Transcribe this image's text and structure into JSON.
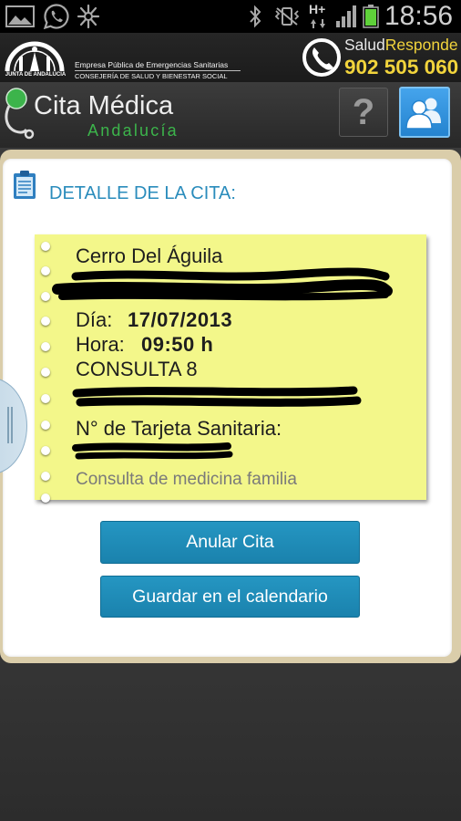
{
  "status_bar": {
    "time": "18:56",
    "network_type": "H+",
    "icons": {
      "notifications": [
        "gallery-icon",
        "whatsapp-icon",
        "burst-icon"
      ],
      "system": [
        "bluetooth-icon",
        "vibrate-icon",
        "signal-icon",
        "battery-icon"
      ]
    }
  },
  "banner": {
    "junta_logo_text": "JUNTA DE ANDALUCIA",
    "org_line1": "Empresa Pública de Emergencias Sanitarias",
    "org_line2": "CONSEJERÍA DE SALUD Y BIENESTAR SOCIAL",
    "service_name_part1": "Salud",
    "service_name_part2": "Responde",
    "service_phone": "902 505 060",
    "icons": {
      "emblem": "junta-emblem-icon",
      "service": "phone-ring-icon"
    }
  },
  "app_bar": {
    "title": "Cita Médica",
    "subtitle": "Andalucía",
    "help_label": "?",
    "icons": {
      "logo": "stethoscope-icon",
      "help": "help-icon",
      "profile": "users-icon"
    }
  },
  "appointment": {
    "heading": "DETALLE DE LA CITA:",
    "health_center": "Cerro Del Águila",
    "day_label": "Día:",
    "day_value": "17/07/2013",
    "time_label": "Hora:",
    "time_value": "09:50 h",
    "room": "CONSULTA 8",
    "health_card_label": "N° de Tarjeta Sanitaria:",
    "service": "Consulta de medicina familia",
    "icons": {
      "heading": "clipboard-icon"
    }
  },
  "actions": {
    "cancel_label": "Anular Cita",
    "save_calendar_label": "Guardar en el calendario"
  },
  "colors": {
    "heading": "#2a8cbc",
    "note": "#f3f78a",
    "button": "#1d8ab6",
    "brand_green": "#3cb44b",
    "brand_yellow": "#f2d43c",
    "profile_button": "#2f8fd8",
    "battery": "#5fd13a"
  }
}
